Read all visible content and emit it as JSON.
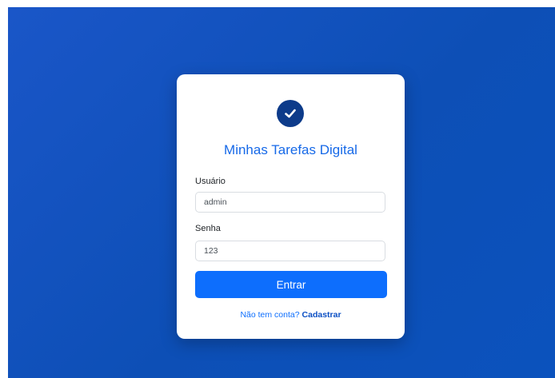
{
  "login": {
    "title": "Minhas Tarefas Digital",
    "username_label": "Usuário",
    "username_value": "admin",
    "password_label": "Senha",
    "password_value": "123",
    "submit_label": "Entrar",
    "signup_prompt": "Não tem conta?",
    "signup_link": "Cadastrar"
  },
  "icons": {
    "logo": "check-circle-icon"
  },
  "colors": {
    "background": "#0d4fb6",
    "logo_circle": "#0d3b8a",
    "title": "#1669e8",
    "button": "#0d6efd",
    "link": "#0d6efd"
  }
}
